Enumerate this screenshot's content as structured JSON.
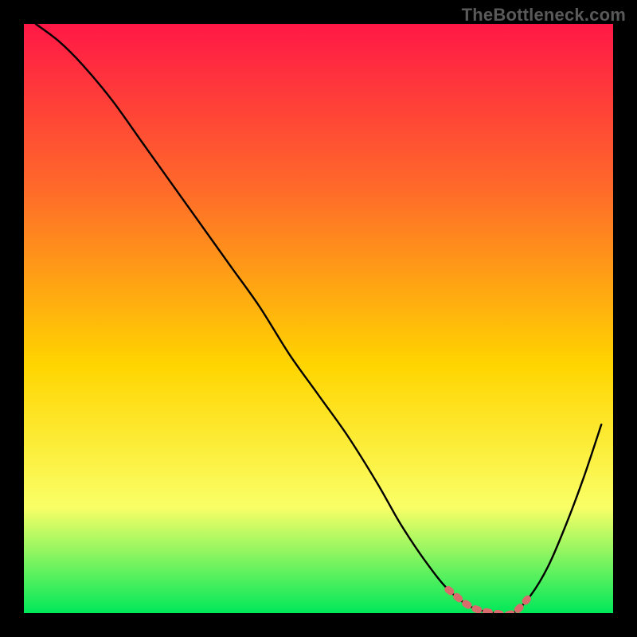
{
  "watermark": "TheBottleneck.com",
  "colors": {
    "background": "#000000",
    "gradient_top": "#ff1846",
    "gradient_mid1": "#ff6a2a",
    "gradient_mid2": "#ffd500",
    "gradient_mid3": "#faff66",
    "gradient_bottom": "#00e85a",
    "curve": "#000000",
    "optimal_band": "#d86b6b"
  },
  "chart_data": {
    "type": "line",
    "title": "",
    "xlabel": "",
    "ylabel": "",
    "xlim": [
      0,
      100
    ],
    "ylim": [
      0,
      100
    ],
    "legend": false,
    "grid": false,
    "series": [
      {
        "name": "bottleneck-curve",
        "x": [
          2,
          6,
          10,
          15,
          20,
          25,
          30,
          35,
          40,
          45,
          50,
          55,
          60,
          64,
          68,
          72,
          76,
          80,
          83,
          86,
          89,
          92,
          95,
          98
        ],
        "values": [
          100,
          97,
          93,
          87,
          80,
          73,
          66,
          59,
          52,
          44,
          37,
          30,
          22,
          15,
          9,
          4,
          1,
          0,
          0,
          3,
          8,
          15,
          23,
          32
        ]
      }
    ],
    "annotations": [
      {
        "name": "optimal-range",
        "x_start": 70,
        "x_end": 85,
        "note": "flat minimum region highlighted in salmon"
      }
    ]
  }
}
